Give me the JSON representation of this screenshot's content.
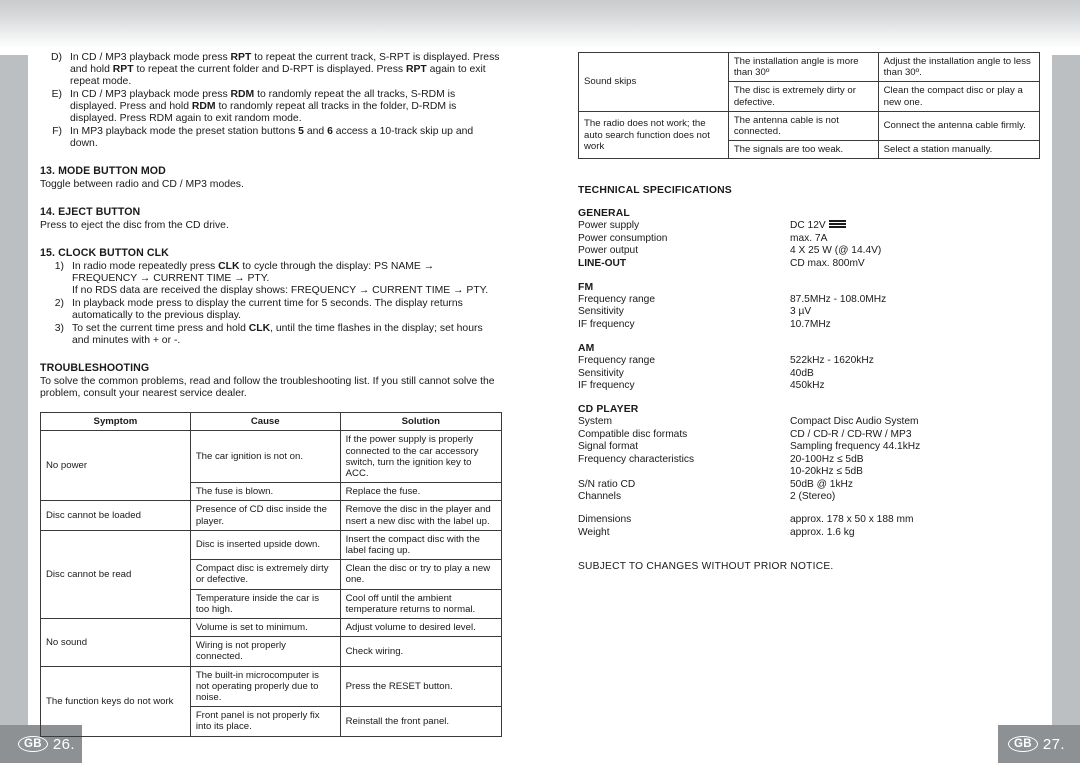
{
  "page": {
    "footer_left": {
      "locale": "GB",
      "number": "26."
    },
    "footer_right": {
      "locale": "GB",
      "number": "27."
    }
  },
  "left_column": {
    "continued_list": [
      {
        "marker": "D)",
        "text_parts": [
          {
            "t": "In CD / MP3 playback mode press ",
            "b": false
          },
          {
            "t": "RPT",
            "b": true
          },
          {
            "t": " to repeat the current track, S-RPT is displayed. Press and hold ",
            "b": false
          },
          {
            "t": "RPT",
            "b": true
          },
          {
            "t": " to repeat the current folder and D-RPT is displayed. Press ",
            "b": false
          },
          {
            "t": "RPT",
            "b": true
          },
          {
            "t": " again to exit repeat mode.",
            "b": false
          }
        ]
      },
      {
        "marker": "E)",
        "text_parts": [
          {
            "t": "In CD / MP3 playback mode press ",
            "b": false
          },
          {
            "t": "RDM",
            "b": true
          },
          {
            "t": " to randomly repeat the all tracks, S-RDM is displayed. Press and hold ",
            "b": false
          },
          {
            "t": "RDM",
            "b": true
          },
          {
            "t": " to randomly repeat all tracks in the folder, D-RDM is displayed. Press RDM again to exit random mode.",
            "b": false
          }
        ]
      },
      {
        "marker": "F)",
        "text_parts": [
          {
            "t": "In MP3 playback mode the preset station buttons ",
            "b": false
          },
          {
            "t": "5",
            "b": true
          },
          {
            "t": " and ",
            "b": false
          },
          {
            "t": "6",
            "b": true
          },
          {
            "t": " access a 10-track skip up and down.",
            "b": false
          }
        ]
      }
    ],
    "section_13": {
      "heading": "13. MODE BUTTON MOD",
      "body": "Toggle between radio and CD / MP3 modes."
    },
    "section_14": {
      "heading": "14. EJECT BUTTON",
      "body": "Press to eject the disc from the CD drive."
    },
    "section_15": {
      "heading": "15. CLOCK BUTTON CLK",
      "items": [
        {
          "marker": "1)",
          "text_parts": [
            {
              "t": "In radio mode repeatedly press ",
              "b": false
            },
            {
              "t": "CLK",
              "b": true
            },
            {
              "t": " to cycle through the display: PS NAME → FREQUENCY → CURRENT TIME → PTY.",
              "b": false
            },
            {
              "t": "\nIf no RDS data are received the display shows: FREQUENCY → CURRENT TIME → PTY.",
              "b": false
            }
          ]
        },
        {
          "marker": "2)",
          "text_parts": [
            {
              "t": "In playback mode press to display the current time for 5 seconds. The display returns automatically to the previous display.",
              "b": false
            }
          ]
        },
        {
          "marker": "3)",
          "text_parts": [
            {
              "t": "To set the current time press and hold ",
              "b": false
            },
            {
              "t": "CLK",
              "b": true
            },
            {
              "t": ", until the time flashes in the display; set hours and minutes with + or -.",
              "b": false
            }
          ]
        }
      ]
    },
    "troubleshooting": {
      "heading": "TROUBLESHOOTING",
      "intro": "To solve the common problems, read and follow the troubleshooting list. If you still cannot solve the problem, consult your nearest service dealer.",
      "columns": [
        "Symptom",
        "Cause",
        "Solution"
      ],
      "rows": [
        {
          "symptom": "No power",
          "span": 2,
          "entries": [
            {
              "cause": "The car ignition is not on.",
              "solution": "If the power supply is properly connected to the car accessory switch, turn the ignition key to ACC."
            },
            {
              "cause": "The fuse is blown.",
              "solution": "Replace the fuse."
            }
          ]
        },
        {
          "symptom": "Disc cannot be loaded",
          "span": 1,
          "entries": [
            {
              "cause": "Presence of CD disc inside the player.",
              "solution": "Remove the disc in the player and nsert a new disc with the label up."
            }
          ]
        },
        {
          "symptom": "Disc cannot be read",
          "span": 3,
          "entries": [
            {
              "cause": "Disc is inserted upside down.",
              "solution": "Insert the compact disc with the label facing up."
            },
            {
              "cause": "Compact disc is extremely dirty or defective.",
              "solution": "Clean the disc or try to play a new one."
            },
            {
              "cause": "Temperature inside the car is too high.",
              "solution": "Cool off until the ambient temperature returns to normal."
            }
          ]
        },
        {
          "symptom": "No sound",
          "span": 2,
          "entries": [
            {
              "cause": "Volume is set to minimum.",
              "solution": "Adjust volume to desired level."
            },
            {
              "cause": "Wiring is not properly connected.",
              "solution": "Check wiring."
            }
          ]
        },
        {
          "symptom": "The function keys do not work",
          "span": 2,
          "entries": [
            {
              "cause": "The built-in microcomputer is not operating properly due to noise.",
              "solution": "Press the RESET button."
            },
            {
              "cause": "Front panel is not properly fix into its place.",
              "solution": "Reinstall the front panel."
            }
          ]
        }
      ]
    }
  },
  "right_column": {
    "troubleshooting_continued": {
      "rows": [
        {
          "symptom": "Sound skips",
          "span": 2,
          "entries": [
            {
              "cause": "The installation angle is more than 30º",
              "solution": "Adjust the installation angle to less than 30º."
            },
            {
              "cause": "The disc is extremely dirty or defective.",
              "solution": "Clean the compact disc or play a new one."
            }
          ]
        },
        {
          "symptom": "The radio does not work; the auto search function does not work",
          "span": 2,
          "entries": [
            {
              "cause": "The antenna cable is not connected.",
              "solution": "Connect the antenna cable firmly."
            },
            {
              "cause": "The signals are too weak.",
              "solution": "Select a station manually."
            }
          ]
        }
      ]
    },
    "specifications": {
      "title": "TECHNICAL SPECIFICATIONS",
      "groups": [
        {
          "heading": "GENERAL",
          "rows": [
            {
              "key": "Power supply",
              "value": "DC 12V",
              "symbol": "dc-power-symbol"
            },
            {
              "key": "Power consumption",
              "value": "max. 7A"
            },
            {
              "key": "Power output",
              "value": "4 X 25 W (@ 14.4V)"
            },
            {
              "key": "LINE-OUT",
              "value": "CD max. 800mV",
              "key_bold": true
            }
          ]
        },
        {
          "heading": "FM",
          "rows": [
            {
              "key": "Frequency range",
              "value": "87.5MHz - 108.0MHz"
            },
            {
              "key": "Sensitivity",
              "value": "3 µV"
            },
            {
              "key": "IF frequency",
              "value": "10.7MHz"
            }
          ]
        },
        {
          "heading": "AM",
          "rows": [
            {
              "key": "Frequency range",
              "value": "522kHz - 1620kHz"
            },
            {
              "key": "Sensitivity",
              "value": "40dB"
            },
            {
              "key": "IF frequency",
              "value": "450kHz"
            }
          ]
        },
        {
          "heading": "CD PLAYER",
          "rows": [
            {
              "key": "System",
              "value": "Compact Disc Audio System"
            },
            {
              "key": "Compatible disc formats",
              "value": "CD / CD-R / CD-RW / MP3"
            },
            {
              "key": "Signal format",
              "value": "Sampling frequency 44.1kHz"
            },
            {
              "key": "Frequency characteristics",
              "value": "20-100Hz ≤ 5dB"
            },
            {
              "key": "",
              "value": "10-20kHz ≤ 5dB"
            },
            {
              "key": "S/N ratio CD",
              "value": "50dB @ 1kHz"
            },
            {
              "key": "Channels",
              "value": "2 (Stereo)"
            }
          ]
        },
        {
          "heading": "",
          "rows": [
            {
              "key": "Dimensions",
              "value": "approx. 178 x 50 x 188 mm"
            },
            {
              "key": "Weight",
              "value": "approx. 1.6 kg"
            }
          ]
        }
      ],
      "notice": "SUBJECT TO CHANGES WITHOUT PRIOR NOTICE."
    }
  }
}
